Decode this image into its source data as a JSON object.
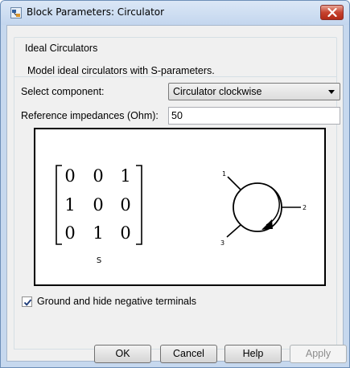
{
  "window": {
    "title": "Block Parameters: Circulator",
    "icon": "simulink-block-icon",
    "close_icon": "close-icon"
  },
  "description": {
    "title": "Ideal Circulators",
    "text": "Model ideal circulators with S-parameters."
  },
  "params": {
    "component_label": "Select component:",
    "component_value": "Circulator clockwise",
    "impedance_label": "Reference impedances (Ohm):",
    "impedance_value": "50"
  },
  "diagram": {
    "matrix_rows": [
      [
        "0",
        "0",
        "1"
      ],
      [
        "1",
        "0",
        "0"
      ],
      [
        "0",
        "1",
        "0"
      ]
    ],
    "matrix_label": "S",
    "ports": [
      "1",
      "2",
      "3"
    ],
    "direction": "clockwise"
  },
  "ground": {
    "label": "Ground and hide negative terminals",
    "checked": true
  },
  "buttons": {
    "ok": "OK",
    "cancel": "Cancel",
    "help": "Help",
    "apply": "Apply"
  }
}
